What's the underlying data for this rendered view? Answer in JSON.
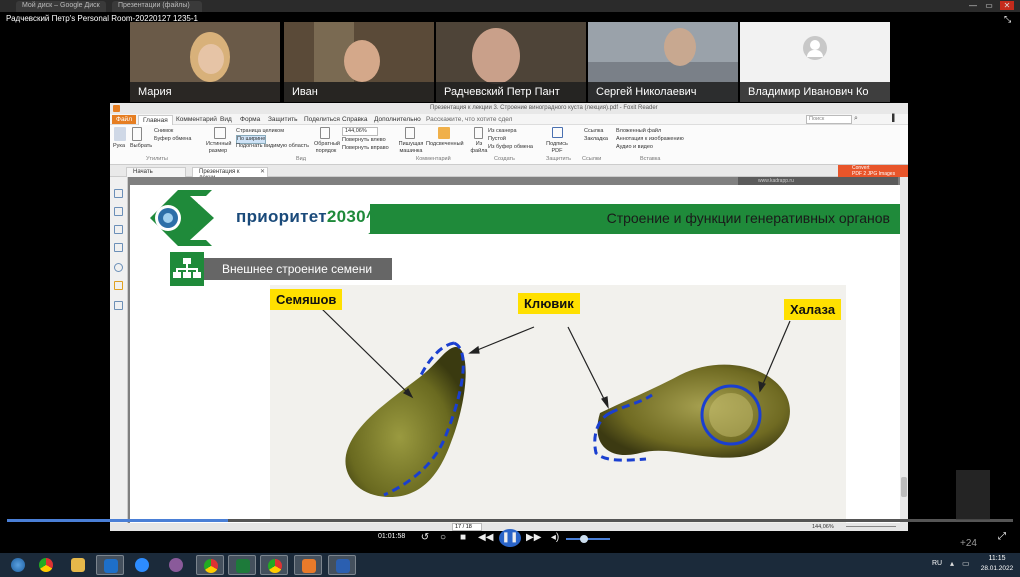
{
  "browser": {
    "tabs": [
      "Мой диск – Google Диск",
      "Презентации (файлы)"
    ],
    "minimize": "—",
    "maximize": "▭",
    "close": "✕"
  },
  "recording": {
    "title": "Радчевский Петр's Personal Room-20220127 1235-1"
  },
  "participants": [
    {
      "name": "Мария"
    },
    {
      "name": "Иван"
    },
    {
      "name": "Радчевский Петр Пант"
    },
    {
      "name": "Сергей Николаевич"
    },
    {
      "name": "Владимир Иванович Ко"
    }
  ],
  "app": {
    "title": "Презентация к лекции 3. Строение виноградного куста (лекция).pdf - Foxit Reader",
    "menu": [
      "Файл",
      "Главная",
      "Комментарий",
      "Вид",
      "Форма",
      "Защитить",
      "Поделиться",
      "Справка",
      "Дополнительно"
    ],
    "tell_me": "Расскажите, что хотите сдел",
    "search_placeholder": "Поиск",
    "ribbon": {
      "hand": "Рука",
      "select": "Выбрать",
      "snapshot": "Снимок",
      "clipboard": "Буфер обмена",
      "actual_size": "Истинный размер",
      "fit_page": "Страница целиком",
      "fit_width": "По ширине",
      "fit_visible": "Подогнать видимую область",
      "zoom_value": "144,06%",
      "rotate_left": "Повернуть влево",
      "rotate_right": "Повернуть вправо",
      "reflow": "Обратный порядок",
      "typewriter": "Пишущая машинка",
      "highlight": "Подсвеченный",
      "from_file": "Из файла",
      "from_scanner": "Из сканера",
      "blank": "Пустой",
      "from_clipboard": "Из буфер обмена",
      "sign_pdf": "Подпись PDF",
      "link": "Ссылка",
      "bookmark": "Закладка",
      "embedded_file": "Вложенный файл",
      "image_annot": "Аннотация к изображению",
      "audio_video": "Аудио и видео",
      "groups": [
        "Утилиты",
        "Вид",
        "Комментарий",
        "Создать",
        "Защитить",
        "Ссылки",
        "Вставка"
      ]
    },
    "convert_banner": {
      "line1": "Convert",
      "line2": "PDF 2 JPG Images"
    },
    "doc_tabs": [
      "Начать",
      "Презентация к лекци..."
    ],
    "page_indicator": "17 / 18",
    "zoom_status": "144,06%"
  },
  "slide": {
    "logo": "приоритет",
    "logo_year": "2030^",
    "title": "Строение и функции генеративных органов",
    "subhead": "Внешнее строение семени",
    "labels": {
      "semyashov": "Семяшов",
      "klyuvik": "Клювик",
      "khalaza": "Халаза"
    },
    "watermark": "www.kadrapp.ru"
  },
  "player": {
    "time": "01:01:58",
    "progress": 0.22,
    "overlay_count": "+24"
  },
  "taskbar": {
    "apps": [
      "start",
      "chrome",
      "explorer",
      "outlook",
      "zoom",
      "media",
      "chrome-2",
      "excel",
      "chrome-3",
      "player",
      "word"
    ],
    "lang": "RU",
    "time": "11:15",
    "date": "28.01.2022"
  },
  "colors": {
    "slide_green": "#1f8a3a",
    "label_yellow": "#ffe000",
    "progress_blue": "#4a7fd6",
    "foxit_orange": "#e67e22"
  }
}
